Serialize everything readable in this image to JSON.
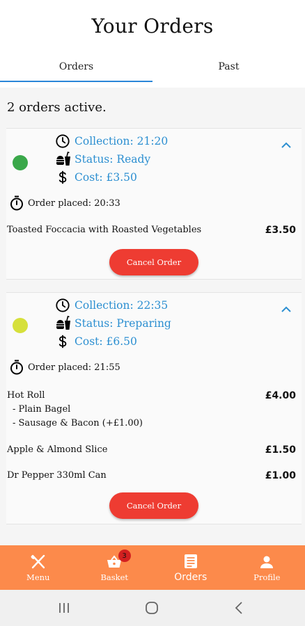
{
  "page_title": "Your Orders",
  "tabs": [
    {
      "label": "Orders",
      "active": true
    },
    {
      "label": "Past",
      "active": false
    }
  ],
  "active_count_text": "2 orders active.",
  "orders": [
    {
      "status_color": "#3aa84a",
      "collection": "Collection: 21:20",
      "status": "Status: Ready",
      "cost": "Cost: £3.50",
      "order_placed": "Order placed: 20:33",
      "items": [
        {
          "name": "Toasted Foccacia with Roasted Vegetables",
          "price": "£3.50",
          "options": []
        }
      ],
      "cancel_label": "Cancel Order"
    },
    {
      "status_color": "#d6e03b",
      "collection": "Collection: 22:35",
      "status": "Status: Preparing",
      "cost": "Cost: £6.50",
      "order_placed": "Order placed: 21:55",
      "items": [
        {
          "name": "Hot Roll",
          "price": "£4.00",
          "options": [
            "- Plain Bagel",
            "- Sausage & Bacon (+£1.00)"
          ]
        },
        {
          "name": "Apple & Almond Slice",
          "price": "£1.50",
          "options": []
        },
        {
          "name": "Dr Pepper 330ml Can",
          "price": "£1.00",
          "options": []
        }
      ],
      "cancel_label": "Cancel Order"
    }
  ],
  "bottom_nav": [
    {
      "label": "Menu",
      "icon": "cutlery-icon",
      "active": false
    },
    {
      "label": "Basket",
      "icon": "basket-icon",
      "active": false,
      "badge": "3"
    },
    {
      "label": "Orders",
      "icon": "list-icon",
      "active": true
    },
    {
      "label": "Profile",
      "icon": "person-icon",
      "active": false
    }
  ],
  "colors": {
    "accent_blue": "#2c8fd1",
    "cancel_red": "#ee3c32",
    "nav_orange": "#fc8a4b"
  }
}
